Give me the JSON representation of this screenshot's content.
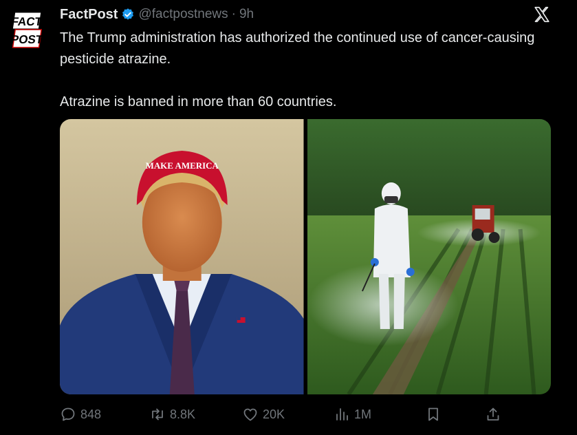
{
  "tweet": {
    "author_name": "FactPost",
    "handle": "@factpostnews",
    "separator": "·",
    "time": "9h",
    "avatar_text_top": "FACT",
    "avatar_text_bottom": "POST",
    "verified_color": "#1d9bf0",
    "text_line1": "The Trump administration has authorized the continued use of cancer-causing pesticide atrazine.",
    "text_line2": "Atrazine is banned in more than 60 countries.",
    "media": [
      {
        "name": "photo-portrait",
        "cap_text": "MAKE AMERICA"
      },
      {
        "name": "photo-field-spraying"
      }
    ]
  },
  "actions": {
    "replies": "848",
    "retweets": "8.8K",
    "likes": "20K",
    "views": "1M"
  },
  "icons": [
    "reply-icon",
    "retweet-icon",
    "like-icon",
    "views-icon",
    "bookmark-icon",
    "share-icon",
    "x-logo-icon",
    "verified-icon"
  ]
}
